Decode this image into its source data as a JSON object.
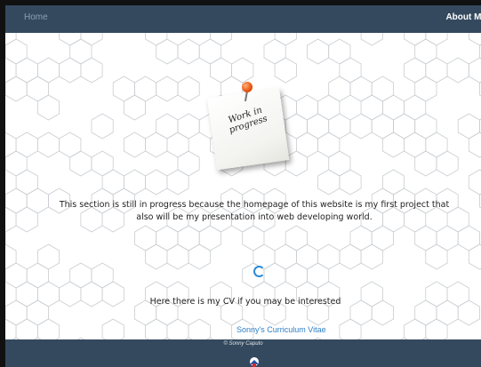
{
  "navbar": {
    "home_label": "Home",
    "about_label": "About Me"
  },
  "main": {
    "note_text": "Work in progress",
    "intro_text": "This section is still in progress because the homepage of this website is my first project that also will be my presentation into web developing world.",
    "cv_text": "Here there is my CV if you may be interested",
    "cv_link_label": "Sonny's Curriculum Vitae"
  },
  "footer": {
    "copyright": "© Sonny Caputo"
  },
  "icons": {
    "spinner": "loading-spinner-icon",
    "note": "pushpin-note-icon",
    "logo": "logo-icon"
  },
  "colors": {
    "navbar_bg": "#34495e",
    "link": "#2c7fc4",
    "spinner": "#2c8ad8",
    "pin": "#e8520e"
  }
}
